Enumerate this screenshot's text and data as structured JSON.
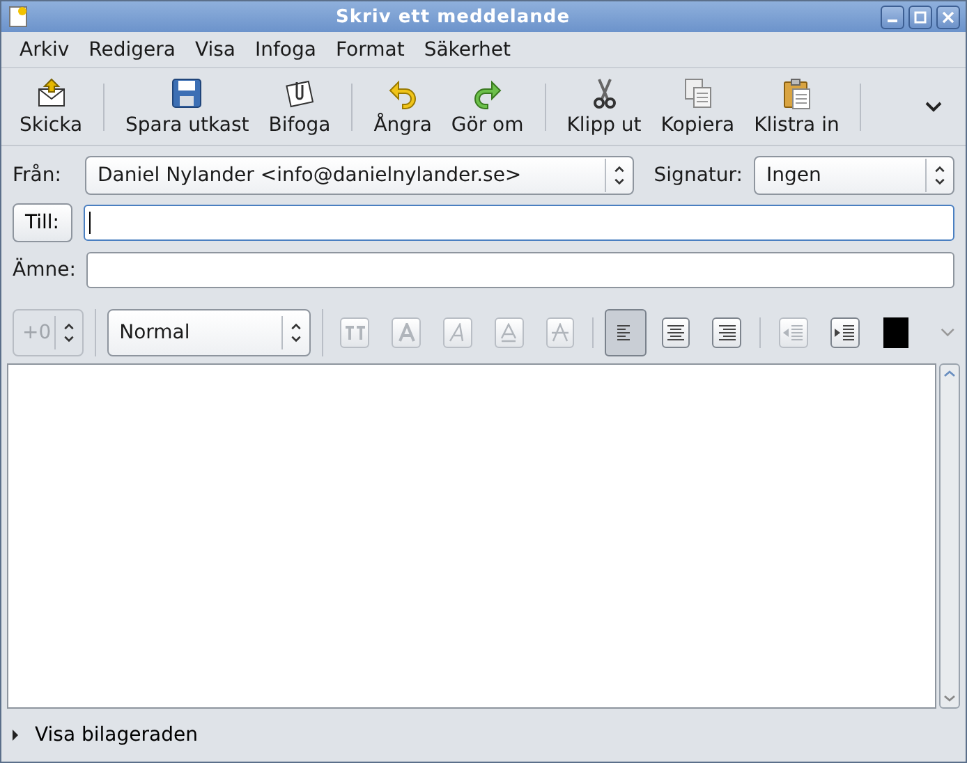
{
  "window": {
    "title": "Skriv ett meddelande"
  },
  "menu": [
    "Arkiv",
    "Redigera",
    "Visa",
    "Infoga",
    "Format",
    "Säkerhet"
  ],
  "toolbar": [
    {
      "kind": "send",
      "label": "Skicka"
    },
    {
      "kind": "separator"
    },
    {
      "kind": "save",
      "label": "Spara utkast"
    },
    {
      "kind": "attach",
      "label": "Bifoga"
    },
    {
      "kind": "separator"
    },
    {
      "kind": "undo",
      "label": "Ångra"
    },
    {
      "kind": "redo",
      "label": "Gör om"
    },
    {
      "kind": "separator"
    },
    {
      "kind": "cut",
      "label": "Klipp ut"
    },
    {
      "kind": "copy",
      "label": "Kopiera"
    },
    {
      "kind": "paste",
      "label": "Klistra in"
    },
    {
      "kind": "separator"
    }
  ],
  "from": {
    "label": "Från:",
    "value": "Daniel Nylander <info@danielnylander.se>"
  },
  "signature": {
    "label": "Signatur:",
    "value": "Ingen"
  },
  "to": {
    "label": "Till:",
    "focused": true
  },
  "subject": {
    "label": "Ämne:"
  },
  "format_bar": {
    "font_size": {
      "value": "+0",
      "disabled": true
    },
    "paragraph": "Normal",
    "buttons": [
      {
        "kind": "size",
        "disabled": true,
        "selected": false
      },
      {
        "kind": "bold",
        "disabled": true,
        "selected": false
      },
      {
        "kind": "italic",
        "disabled": true,
        "selected": false
      },
      {
        "kind": "underline",
        "disabled": true,
        "selected": false
      },
      {
        "kind": "strike",
        "disabled": true,
        "selected": false
      },
      {
        "kind": "separator"
      },
      {
        "kind": "align-left",
        "disabled": false,
        "selected": true
      },
      {
        "kind": "align-center",
        "disabled": false,
        "selected": false
      },
      {
        "kind": "align-right",
        "disabled": false,
        "selected": false
      },
      {
        "kind": "separator"
      },
      {
        "kind": "outdent",
        "disabled": true,
        "selected": false
      },
      {
        "kind": "indent",
        "disabled": false,
        "selected": false
      }
    ],
    "text_color": {
      "color": "#000000"
    }
  },
  "attachments": {
    "label": "Visa bilageraden",
    "expanded": false
  }
}
